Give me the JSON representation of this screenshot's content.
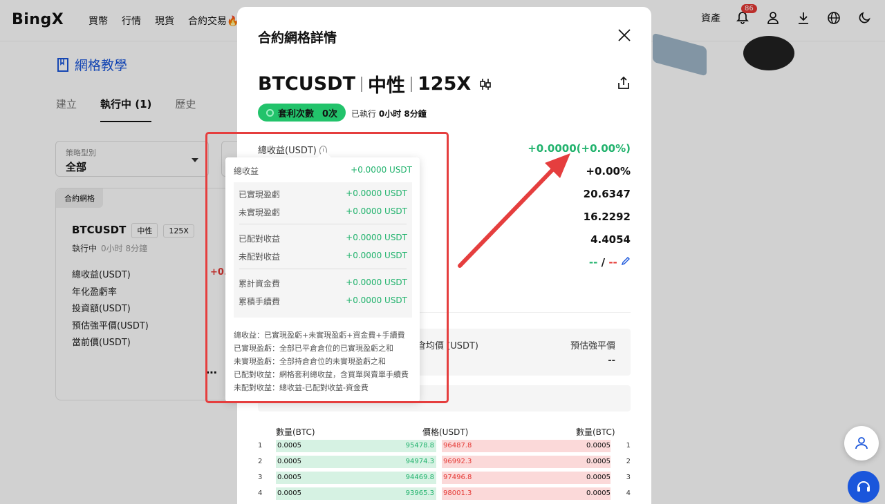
{
  "nav": {
    "logo": "BingX",
    "links": [
      "買幣",
      "行情",
      "現貨",
      "合約交易"
    ],
    "assets": "資產",
    "notif_count": "86"
  },
  "bg": {
    "tutorial": "網格教學",
    "tabs": [
      "建立",
      "執行中 (1)",
      "歷史"
    ],
    "filter_label": "策略型別",
    "filter_value": "全部",
    "card_tag": "合約網格",
    "card_symbol": "BTCUSDT",
    "card_pill1": "中性",
    "card_pill2": "125X",
    "card_status": "執行中",
    "card_time": "0小时 8分鐘",
    "card_rows": [
      "總收益(USDT)",
      "年化盈虧率",
      "投資額(USDT)",
      "預估強平價(USDT)",
      "當前價(USDT)"
    ],
    "card_value": "+0.",
    "card_dots": "⋯"
  },
  "modal": {
    "title": "合約網格詳情",
    "symbol": "BTCUSDT",
    "mode": "中性",
    "leverage": "125X",
    "arb_label": "套利次數",
    "arb_count": "0次",
    "running_label": "已執行",
    "running_time": "0小时 8分鐘",
    "total_profit_label": "總收益(USDT)",
    "total_profit_value": "+0.0000(+0.00%)",
    "values": [
      "+0.00%",
      "20.6347",
      "16.2292",
      "4.4054"
    ],
    "tp_sl_a": "--",
    "tp_sl_sep": "/",
    "tp_sl_b": "--",
    "avg_price_label": "倉均價 (USDT)",
    "liq_label": "預估強平價",
    "liq_value": "--",
    "orderbook": {
      "head_qty_left": "數量(BTC)",
      "head_price": "價格(USDT)",
      "head_qty_right": "數量(BTC)",
      "rows": [
        {
          "idx": "1",
          "bq": "0.0005",
          "bp": "95478.8",
          "ap": "96487.8",
          "aq": "0.0005"
        },
        {
          "idx": "2",
          "bq": "0.0005",
          "bp": "94974.3",
          "ap": "96992.3",
          "aq": "0.0005"
        },
        {
          "idx": "3",
          "bq": "0.0005",
          "bp": "94469.8",
          "ap": "97496.8",
          "aq": "0.0005"
        },
        {
          "idx": "4",
          "bq": "0.0005",
          "bp": "93965.3",
          "ap": "98001.3",
          "aq": "0.0005"
        }
      ]
    }
  },
  "tooltip": {
    "total_label": "總收益",
    "total_value": "+0.0000 USDT",
    "rows": [
      {
        "label": "已實現盈虧",
        "value": "+0.0000 USDT"
      },
      {
        "label": "未實現盈虧",
        "value": "+0.0000 USDT"
      },
      {
        "label": "已配對收益",
        "value": "+0.0000 USDT"
      },
      {
        "label": "未配對收益",
        "value": "+0.0000 USDT"
      },
      {
        "label": "累計資金費",
        "value": "+0.0000 USDT"
      },
      {
        "label": "累積手續費",
        "value": "+0.0000 USDT"
      }
    ],
    "desc": [
      "總收益：已實現盈虧+未實現盈虧+資金費+手續費",
      "已實現盈虧：全部已平倉倉位的已實現盈虧之和",
      "未實現盈虧：全部持倉倉位的未實現盈虧之和",
      "已配對收益：網格套利總收益，含買單與賣單手續費",
      "未配對收益：總收益-已配對收益-資金費"
    ]
  },
  "colors": {
    "green": "#20b26c",
    "red": "#e53935",
    "brand_blue": "#1a56db",
    "highlight_red": "#e53e3e"
  }
}
